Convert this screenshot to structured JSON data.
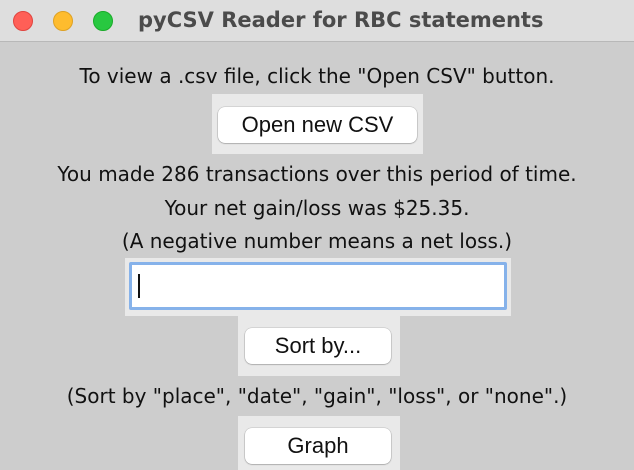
{
  "window": {
    "title": "pyCSV Reader for RBC statements"
  },
  "main": {
    "instruction": "To view a .csv file, click the \"Open CSV\" button.",
    "open_button_label": "Open new CSV",
    "transactions_text": "You made 286 transactions over this period of time.",
    "net_text": "Your net gain/loss was $25.35.",
    "net_note": "(A negative number means a net loss.)",
    "input_value": "",
    "sort_button_label": "Sort by...",
    "sort_hint": "(Sort by \"place\", \"date\", \"gain\", \"loss\", or \"none\".)",
    "graph_button_label": "Graph"
  }
}
